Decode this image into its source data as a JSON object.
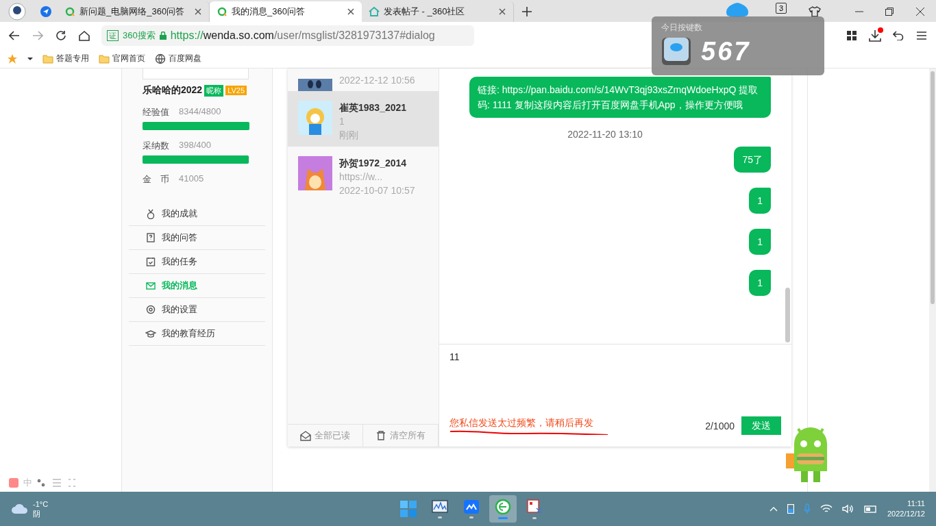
{
  "browser": {
    "tabs": [
      {
        "title": "新问题_电脑网络_360问答",
        "selected": false
      },
      {
        "title": "我的消息_360问答",
        "selected": true
      },
      {
        "title": "发表帖子 - _360社区",
        "selected": false
      }
    ],
    "tab_count_badge": "3",
    "address": {
      "badge": "证",
      "search_label": "360搜索",
      "scheme": "https://",
      "host": "wenda.so.com",
      "path": "/user/msglist/3281973137#dialog"
    },
    "bookmarks": [
      {
        "kind": "folder",
        "label": "答题专用"
      },
      {
        "kind": "folder",
        "label": "官网首页"
      },
      {
        "kind": "web",
        "label": "百度网盘"
      }
    ]
  },
  "key_counter": {
    "title": "今日按键数",
    "count": "567"
  },
  "profile": {
    "name": "乐哈哈的2022",
    "nickname_tag": "昵称",
    "level_tag": "LV25",
    "stats": [
      {
        "kind": "bar",
        "label": "经验值",
        "value": "8344/4800",
        "level": 1
      },
      {
        "kind": "bar",
        "label": "采纳数",
        "value": "398/400",
        "level": 0.995
      },
      {
        "kind": "plain",
        "label": "金　币",
        "value": "41005"
      }
    ]
  },
  "menu": [
    {
      "label": "我的成就",
      "selected": false
    },
    {
      "label": "我的问答",
      "selected": false
    },
    {
      "label": "我的任务",
      "selected": false
    },
    {
      "label": "我的消息",
      "selected": true
    },
    {
      "label": "我的设置",
      "selected": false
    },
    {
      "label": "我的教育经历",
      "selected": false
    }
  ],
  "conversations": [
    {
      "time": "2022-12-12 10:56",
      "selected": false
    },
    {
      "name": "崔英1983_2021",
      "preview": "1",
      "time": "刚刚",
      "selected": true
    },
    {
      "name": "孙贺1972_2014",
      "preview": "https://w...",
      "time": "2022-10-07 10:57",
      "selected": false
    }
  ],
  "list_actions": [
    "全部已读",
    "清空所有"
  ],
  "messages": [
    {
      "kind": "bubble",
      "text": "链接: https://pan.baidu.com/s/14WvT3qj93xsZmqWdoeHxpQ 提取码: 1111 复制这段内容后打开百度网盘手机App，操作更方便哦"
    },
    {
      "kind": "time",
      "text": "2022-11-20 13:10"
    },
    {
      "kind": "bubble",
      "text": "75了"
    },
    {
      "kind": "bubble",
      "text": "1"
    },
    {
      "kind": "bubble",
      "text": "1"
    },
    {
      "kind": "bubble",
      "text": "1"
    }
  ],
  "composer": {
    "value": "11",
    "error": "您私信发送太过频繁，请稍后再发",
    "counter": "2/1000",
    "send": "发送"
  },
  "ime": {
    "label": "中"
  },
  "taskbar": {
    "weather": {
      "temp": "-1°C",
      "condition": "阴"
    },
    "apps": [
      {
        "selected": false
      },
      {
        "selected": false
      },
      {
        "selected": true
      },
      {
        "selected": false
      }
    ],
    "clock": {
      "time": "11:11",
      "date": "2022/12/12"
    }
  }
}
